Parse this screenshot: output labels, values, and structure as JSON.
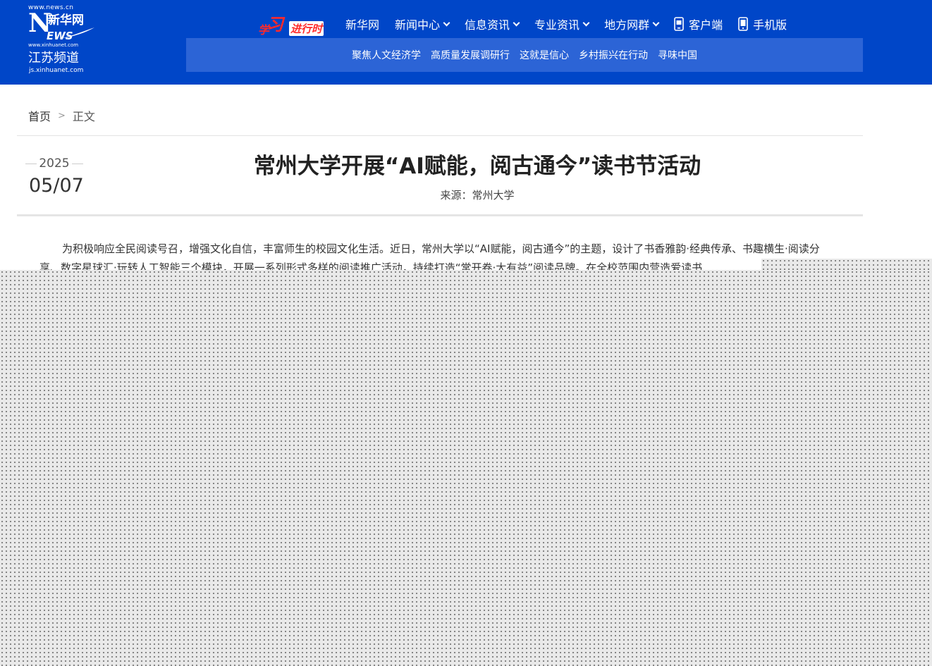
{
  "header": {
    "logo": {
      "url_top": "www.news.cn",
      "brand_cn": "新华网",
      "brand_en_initial": "N",
      "brand_en_rest": "EWS",
      "url_mid": "www.xinhuanet.com",
      "channel": "江苏频道",
      "url_bottom": "js.xinhuanet.com"
    },
    "xuexi": {
      "part1": "学",
      "part2": "习",
      "part3": "进行时"
    },
    "nav": [
      {
        "label": "新华网",
        "dropdown": false
      },
      {
        "label": "新闻中心",
        "dropdown": true
      },
      {
        "label": "信息资讯",
        "dropdown": true
      },
      {
        "label": "专业资讯",
        "dropdown": true
      },
      {
        "label": "地方网群",
        "dropdown": true
      },
      {
        "label": "客户端",
        "icon": "app-device-icon"
      },
      {
        "label": "手机版",
        "icon": "phone-icon"
      }
    ],
    "subnav": [
      "聚焦人文经济学",
      "高质量发展调研行",
      "这就是信心",
      "乡村振兴在行动",
      "寻味中国"
    ]
  },
  "breadcrumb": {
    "home": "首页",
    "separator": ">",
    "current": "正文"
  },
  "article": {
    "year": "2025",
    "month_day": "05/07",
    "title": "常州大学开展“AI赋能，阅古通今”读书节活动",
    "source": "来源：常州大学",
    "paragraph": "为积极响应全民阅读号召，增强文化自信，丰富师生的校园文化生活。近日，常州大学以“AI赋能，阅古通今”的主题，设计了书香雅韵·经典传承、书趣横生·阅读分享、数字星球汇·玩转人工智能三个模块，开展一系列形式多样的阅读推广活动，持续打造“常开卷·大有益”阅读品牌。在全校范围内营造爱读书"
  },
  "colors": {
    "header_bg": "#0046c8",
    "subnav_bg": "#2c64d6",
    "xuexi_red": "#ff2a2a",
    "overlay_dots": "#6c6c6c"
  }
}
